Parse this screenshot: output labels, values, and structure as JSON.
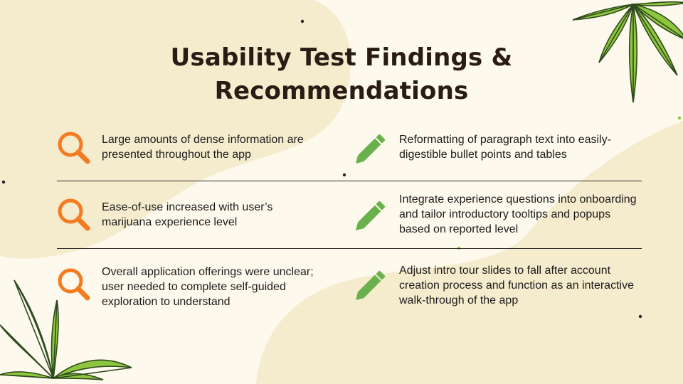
{
  "title": "Usability Test Findings & Recommendations",
  "colors": {
    "background": "#fdf9ec",
    "blob": "#f5ebcd",
    "title": "#2a1b14",
    "finding_icon": "#f47b20",
    "recommendation_icon": "#6ab04c",
    "leaf_green": "#8fc63f",
    "leaf_dark": "#2d4a1c"
  },
  "rows": [
    {
      "finding": "Large amounts of dense information are presented throughout the app",
      "recommendation": "Reformatting of paragraph text into easily-digestible bullet points and tables",
      "finding_icon": "magnifying-glass-icon",
      "recommendation_icon": "pencil-icon"
    },
    {
      "finding": "Ease-of-use increased with user’s marijuana experience level",
      "recommendation": "Integrate experience questions into onboarding and tailor introductory tooltips and popups based on reported level",
      "finding_icon": "magnifying-glass-icon",
      "recommendation_icon": "pencil-icon"
    },
    {
      "finding": "Overall application offerings were unclear; user needed to complete self-guided exploration to understand",
      "recommendation": "Adjust intro tour slides to fall after account creation process and function as an interactive walk-through of the app",
      "finding_icon": "magnifying-glass-icon",
      "recommendation_icon": "pencil-icon"
    }
  ]
}
